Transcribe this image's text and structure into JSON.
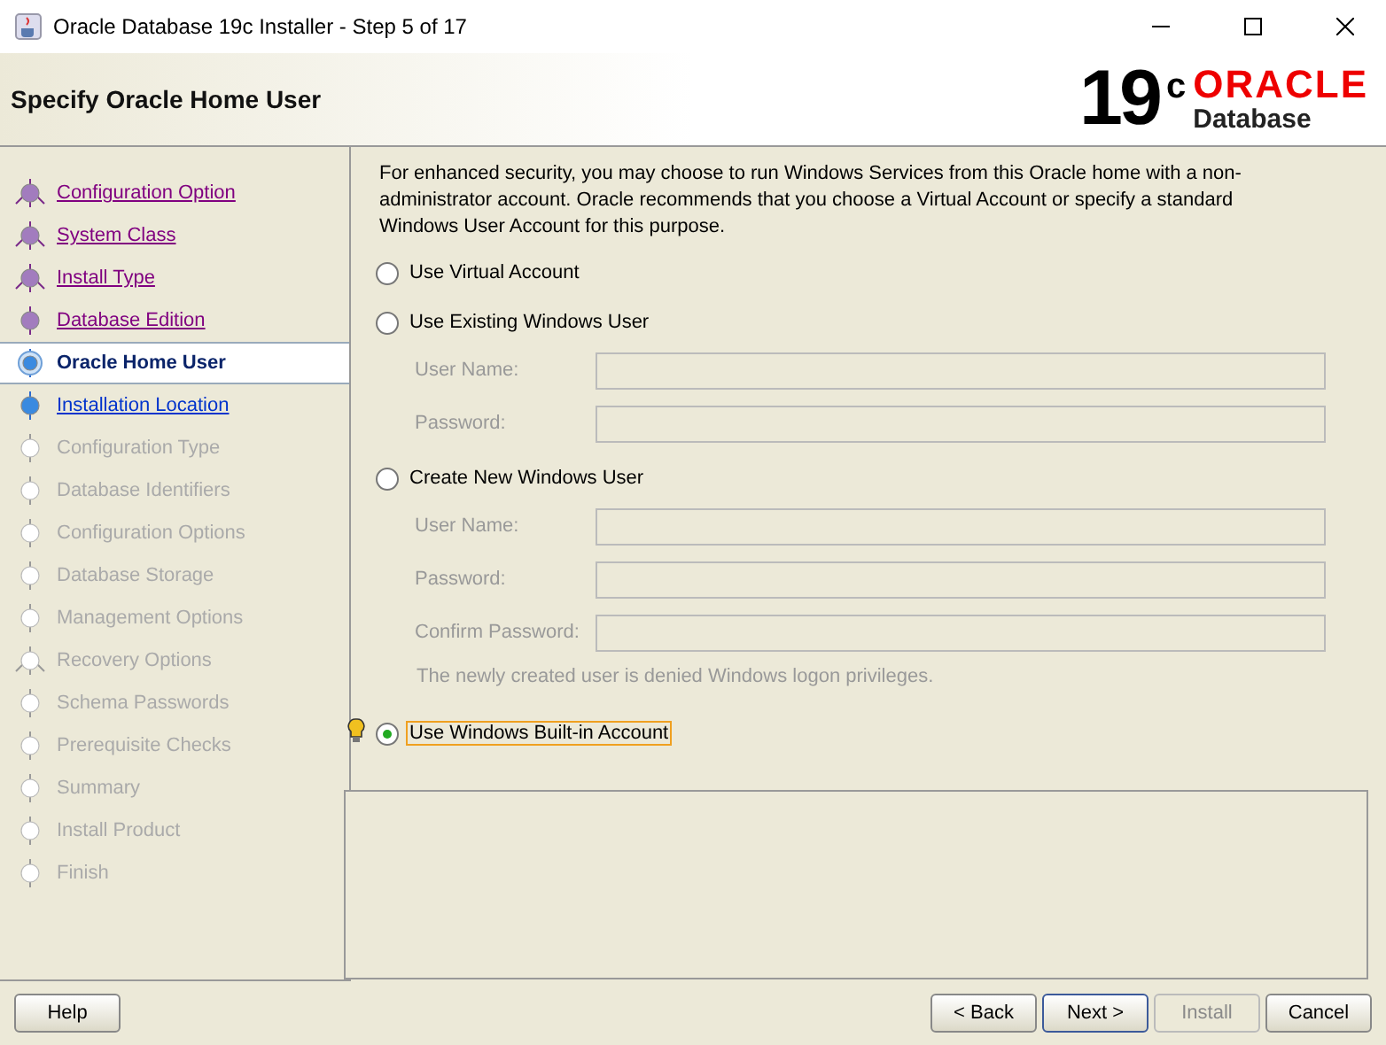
{
  "window": {
    "title": "Oracle Database 19c Installer - Step 5 of 17"
  },
  "header": {
    "title": "Specify Oracle Home User",
    "version": "19",
    "version_sup": "c",
    "brand": "ORACLE",
    "product": "Database"
  },
  "steps": [
    {
      "label": "Configuration Option",
      "kind": "done",
      "fork": true
    },
    {
      "label": "System Class",
      "kind": "done",
      "fork": true
    },
    {
      "label": "Install Type",
      "kind": "done",
      "fork": true
    },
    {
      "label": "Database Edition",
      "kind": "done",
      "fork": false
    },
    {
      "label": "Oracle Home User",
      "kind": "current",
      "fork": false
    },
    {
      "label": "Installation Location",
      "kind": "next",
      "fork": false
    },
    {
      "label": "Configuration Type",
      "kind": "pending",
      "fork": false
    },
    {
      "label": "Database Identifiers",
      "kind": "pending",
      "fork": false
    },
    {
      "label": "Configuration Options",
      "kind": "pending",
      "fork": false
    },
    {
      "label": "Database Storage",
      "kind": "pending",
      "fork": false
    },
    {
      "label": "Management Options",
      "kind": "pending",
      "fork": false
    },
    {
      "label": "Recovery Options",
      "kind": "pending",
      "fork": true
    },
    {
      "label": "Schema Passwords",
      "kind": "pending",
      "fork": false
    },
    {
      "label": "Prerequisite Checks",
      "kind": "pending",
      "fork": false
    },
    {
      "label": "Summary",
      "kind": "pending",
      "fork": false
    },
    {
      "label": "Install Product",
      "kind": "pending",
      "fork": false
    },
    {
      "label": "Finish",
      "kind": "pending",
      "fork": false
    }
  ],
  "intro": "For enhanced security, you may choose to run Windows Services from this Oracle home with a non-administrator account. Oracle recommends that you choose a Virtual Account or specify a standard Windows User Account for this purpose.",
  "options": [
    {
      "label": "Use Virtual Account",
      "selected": false
    },
    {
      "label": "Use Existing Windows User",
      "selected": false,
      "fields": [
        {
          "label": "User Name:"
        },
        {
          "label": "Password:"
        }
      ]
    },
    {
      "label": "Create New Windows User",
      "selected": false,
      "fields": [
        {
          "label": "User Name:"
        },
        {
          "label": "Password:"
        },
        {
          "label": "Confirm Password:"
        }
      ],
      "note": "The newly created user is denied Windows logon privileges."
    },
    {
      "label": "Use Windows Built-in Account",
      "selected": true
    }
  ],
  "buttons_left": [
    {
      "label": "Help",
      "disabled": false
    }
  ],
  "buttons_right": [
    {
      "label": "< Back",
      "disabled": false,
      "default": false
    },
    {
      "label": "Next >",
      "disabled": false,
      "default": true
    },
    {
      "label": "Install",
      "disabled": true,
      "default": false
    },
    {
      "label": "Cancel",
      "disabled": false,
      "default": false
    }
  ]
}
